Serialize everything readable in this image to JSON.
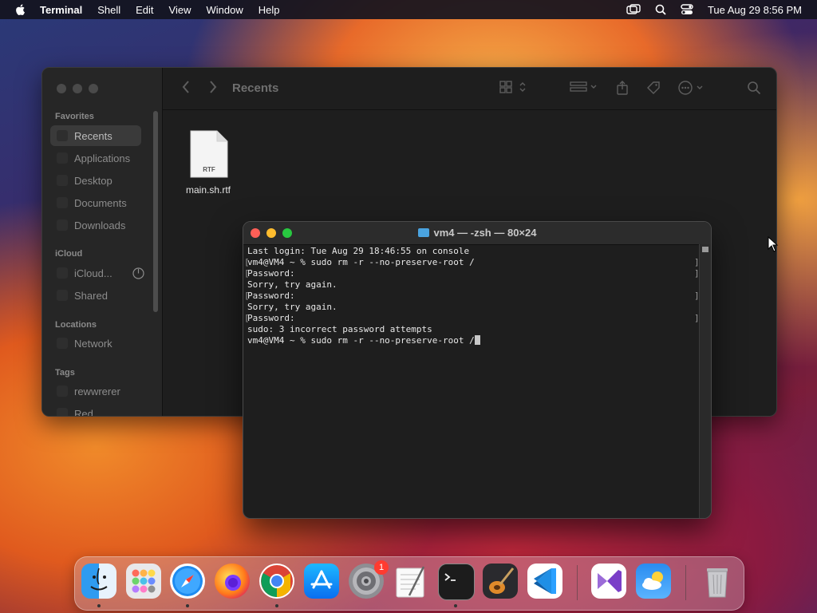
{
  "menubar": {
    "app_name": "Terminal",
    "items": [
      "Shell",
      "Edit",
      "View",
      "Window",
      "Help"
    ],
    "clock": "Tue Aug 29  8:56 PM"
  },
  "finder": {
    "title": "Recents",
    "sidebar": {
      "favorites_header": "Favorites",
      "favorites": [
        "Recents",
        "Applications",
        "Desktop",
        "Documents",
        "Downloads"
      ],
      "icloud_header": "iCloud",
      "icloud": [
        "iCloud...",
        "Shared"
      ],
      "locations_header": "Locations",
      "locations": [
        "Network"
      ],
      "tags_header": "Tags",
      "tags": [
        "rewwrerer",
        "Red"
      ]
    },
    "file": {
      "name": "main.sh.rtf",
      "type_label": "RTF"
    }
  },
  "terminal": {
    "title": "vm4 — -zsh — 80×24",
    "lines": [
      "Last login: Tue Aug 29 18:46:55 on console",
      "vm4@VM4 ~ % sudo rm -r --no-preserve-root /",
      "Password:",
      "Sorry, try again.",
      "Password:",
      "Sorry, try again.",
      "Password:",
      "sudo: 3 incorrect password attempts",
      "vm4@VM4 ~ % sudo rm -r --no-preserve-root /"
    ]
  },
  "dock": {
    "apps": [
      "Finder",
      "Launchpad",
      "Safari",
      "Firefox",
      "Chrome",
      "App Store",
      "System Settings",
      "TextEdit",
      "Terminal",
      "GarageBand",
      "Visual Studio Code",
      "Visual Studio",
      "Weather",
      "Trash"
    ],
    "settings_badge": "1"
  },
  "colors": {
    "menubar_bg": "#14141e",
    "terminal_red": "#ff5f57",
    "terminal_yellow": "#febc2e",
    "terminal_green": "#28c840"
  }
}
